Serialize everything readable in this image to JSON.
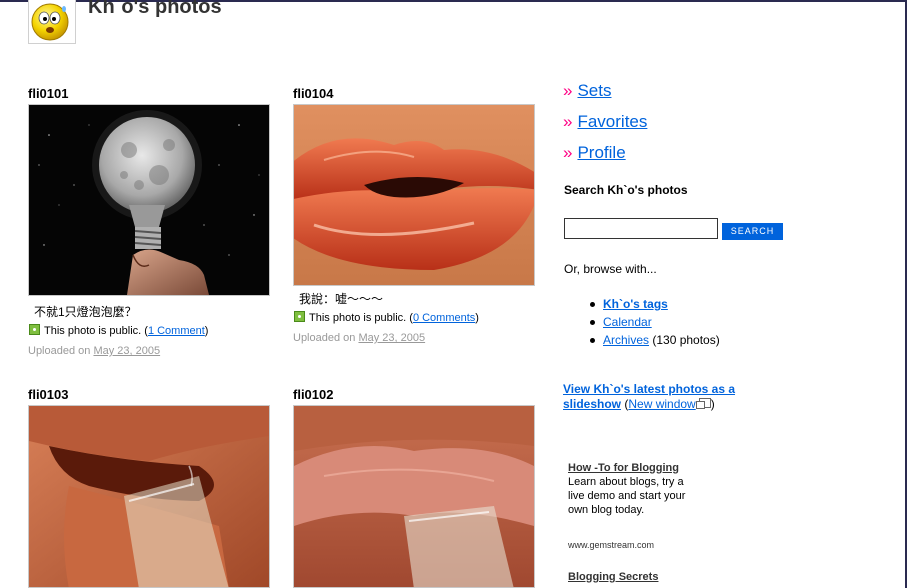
{
  "header": {
    "title": "Kh`o's photos",
    "avatar_icon": "smiley-face-icon"
  },
  "photos": [
    {
      "title": "fli0101",
      "caption": "不就1只燈泡泡麼？",
      "privacy_prefix": "This photo is public. (",
      "comments": "1 Comment",
      "privacy_suffix": ")",
      "uploaded_prefix": "Uploaded on ",
      "date": "May 23, 2005",
      "image": "moon-lightbulb-image"
    },
    {
      "title": "fli0104",
      "caption": "我說：嘘～～～",
      "privacy_prefix": "This photo is public. (",
      "comments": "0 Comments",
      "privacy_suffix": ")",
      "uploaded_prefix": "Uploaded on ",
      "date": "May 23, 2005",
      "image": "lips-image"
    },
    {
      "title": "fli0103",
      "image": "mouth-bottle-image"
    },
    {
      "title": "fli0102",
      "image": "tongue-bottle-image"
    }
  ],
  "sidebar": {
    "links": [
      "Sets",
      "Favorites",
      "Profile"
    ],
    "raquo": "»",
    "search": {
      "heading": "Search Kh`o's photos",
      "value": "",
      "button": "SEARCH"
    },
    "browse_label": "Or, browse with...",
    "browse": [
      {
        "label": "Kh`o's tags",
        "suffix": ""
      },
      {
        "label": "Calendar",
        "suffix": ""
      },
      {
        "label": "Archives",
        "suffix": " (130 photos)"
      }
    ],
    "slideshow": {
      "link": "View Kh`o's latest photos as a slideshow",
      "open_paren": " (",
      "new_window": "New window",
      "close_paren": ")"
    },
    "ads": [
      {
        "title": "How -To for Blogging",
        "body": "Learn about blogs, try a live demo and start your own blog today.",
        "url": "www.gemstream.com"
      },
      {
        "title": "Blogging Secrets"
      }
    ]
  },
  "colors": {
    "link": "#0063dc",
    "accent": "#ff0084",
    "public_icon": "#7fbf3f"
  }
}
